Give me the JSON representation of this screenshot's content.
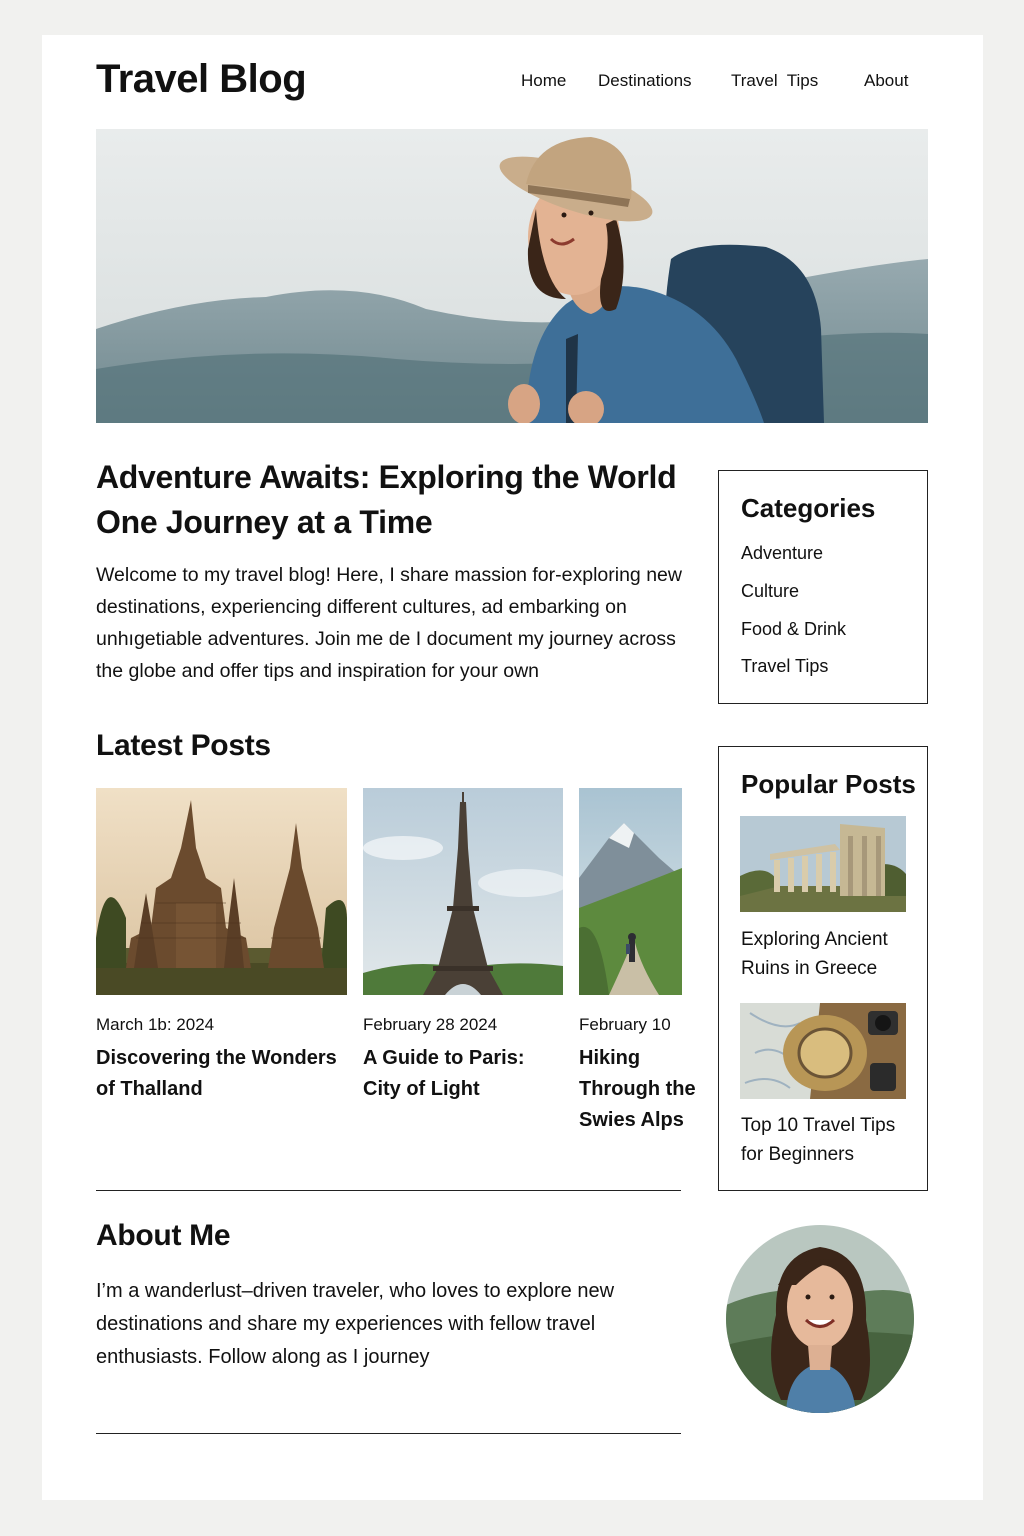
{
  "header": {
    "title": "Travel Blog",
    "nav": [
      "Home",
      "Destinations",
      "Travel  Tips",
      "About"
    ]
  },
  "intro": {
    "title": "Adventure Awaits: Exploring the World One Journey at a Time",
    "text": "Welcome to my travel blog! Here, I share massion for-exploring new destinations, experiencing different cultures, ad embarking on unhıgetiable adventures.  Join me de I document my journey across the globe and offer tips and inspiration for your own"
  },
  "latest": {
    "heading": "Latest Posts",
    "posts": [
      {
        "date": "March 1b: 2024",
        "title": "Discovering the Wonders of Thalland",
        "image": "temple-image"
      },
      {
        "date": "February 28 2024",
        "title": "A Guide to Paris: City of Light",
        "image": "eiffel-tower-image"
      },
      {
        "date": "February 10",
        "title": "Hiking Through the Swies Alps",
        "image": "alps-image"
      }
    ]
  },
  "categories": {
    "heading": "Categories",
    "items": [
      "Adventure",
      "Culture",
      "Food & Drink",
      "Travel Tips"
    ]
  },
  "popular": {
    "heading": "Popular Posts",
    "posts": [
      {
        "title": "Exploring Ancient Ruins in Greece",
        "image": "ruins-image"
      },
      {
        "title": "Top 10 Travel Tips for Beginners",
        "image": "hat-map-image"
      }
    ]
  },
  "about": {
    "heading": "About Me",
    "text": "I’m a wanderlust–driven traveler, who loves to explore new destinations and share my experiences with fellow travel enthusiasts. Follow along as I journey"
  },
  "colors": {
    "background": "#f1f1ef",
    "card": "#ffffff",
    "text": "#111111",
    "border": "#222222"
  }
}
